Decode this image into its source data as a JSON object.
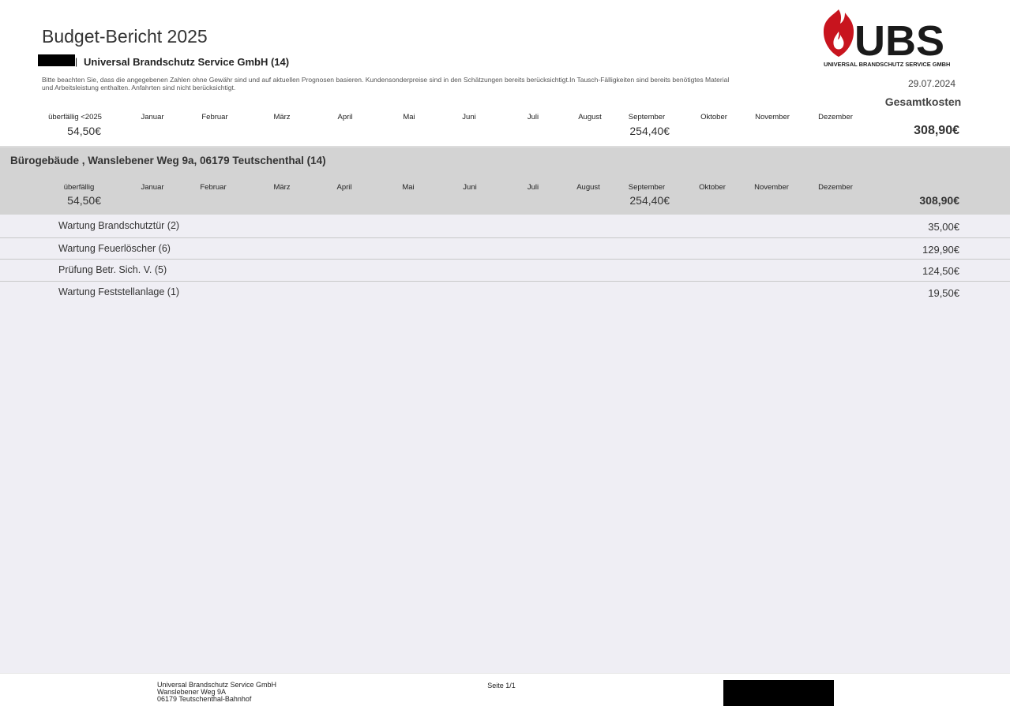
{
  "header": {
    "title": "Budget-Bericht 2025",
    "pipe": "|",
    "company": "Universal Brandschutz Service GmbH (14)",
    "note": "Bitte beachten Sie, dass die angegebenen Zahlen ohne Gewähr sind und auf aktuellen Prognosen basieren. Kundensonderpreise sind in den Schätzungen bereits berücksichtigt.In Tausch-Fälligkeiten sind bereits benötigtes Material und Arbeitsleistung enthalten. Anfahrten sind nicht berücksichtigt.",
    "logo": {
      "letters": "UBS",
      "subtitle": "UNIVERSAL BRANDSCHUTZ SERVICE GMBH",
      "color_red": "#c8141e",
      "color_black": "#1a1a1a"
    },
    "date": "29.07.2024",
    "total_label": "Gesamtkosten"
  },
  "summary": {
    "overdue_label": "überfällig <2025",
    "months": [
      "Januar",
      "Februar",
      "März",
      "April",
      "Mai",
      "Juni",
      "Juli",
      "August",
      "September",
      "Oktober",
      "November",
      "Dezember"
    ],
    "overdue_value": "54,50€",
    "september_value": "254,40€",
    "total_value": "308,90€"
  },
  "site": {
    "title": "Bürogebäude , Wanslebener Weg 9a, 06179 Teutschenthal (14)",
    "overdue_label": "überfällig",
    "months": [
      "Januar",
      "Februar",
      "März",
      "April",
      "Mai",
      "Juni",
      "Juli",
      "August",
      "September",
      "Oktober",
      "November",
      "Dezember"
    ],
    "overdue_value": "54,50€",
    "september_value": "254,40€",
    "total_value": "308,90€",
    "bg_color": "#d3d3d3"
  },
  "items": [
    {
      "label": "Wartung Brandschutztür (2)",
      "value": "35,00€"
    },
    {
      "label": "Wartung Feuerlöscher (6)",
      "value": "129,90€"
    },
    {
      "label": "Prüfung Betr. Sich. V. (5)",
      "value": "124,50€"
    },
    {
      "label": "Wartung Feststellanlage (1)",
      "value": "19,50€"
    }
  ],
  "footer": {
    "address": [
      "Universal Brandschutz Service GmbH",
      "Wanslebener Weg 9A",
      "06179 Teutschenthal-Bahnhof"
    ],
    "page": "Seite 1/1"
  },
  "colors": {
    "content_bg": "#efeef4",
    "redaction": "#000000"
  }
}
